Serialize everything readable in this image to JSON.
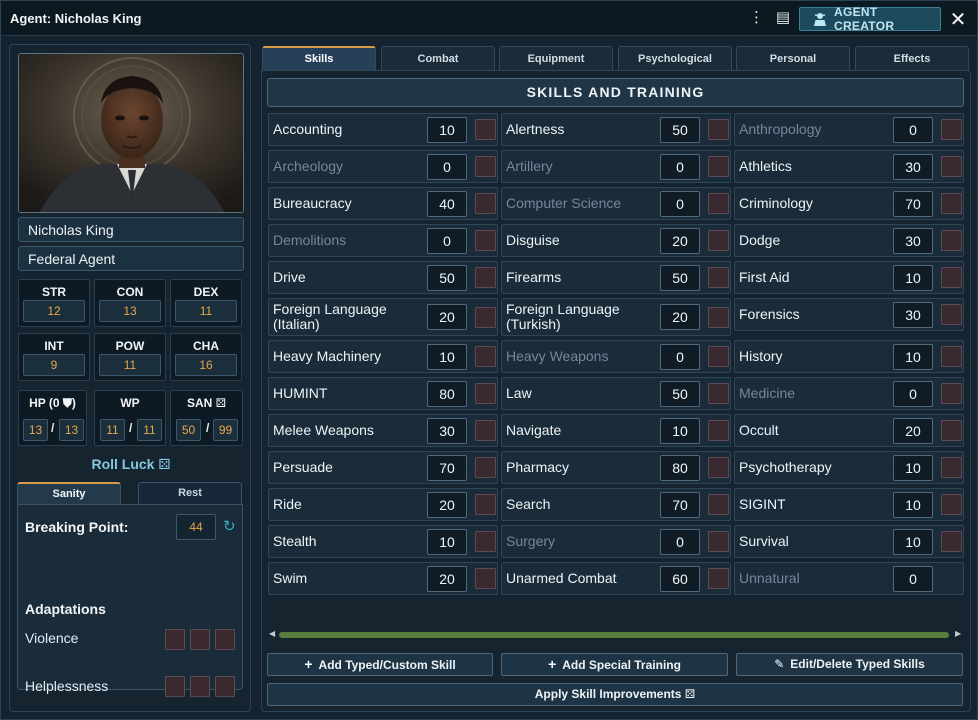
{
  "window": {
    "title": "Agent: Nicholas King",
    "creator_label": "AGENT CREATOR",
    "kebab_glyph": "⋮",
    "sheet_glyph": "▤",
    "close_glyph": "✕"
  },
  "agent": {
    "name": "Nicholas King",
    "profession": "Federal Agent"
  },
  "stats": [
    {
      "label": "STR",
      "value": "12"
    },
    {
      "label": "CON",
      "value": "13"
    },
    {
      "label": "DEX",
      "value": "11"
    },
    {
      "label": "INT",
      "value": "9"
    },
    {
      "label": "POW",
      "value": "11"
    },
    {
      "label": "CHA",
      "value": "16"
    }
  ],
  "derived": {
    "hp": {
      "label": "HP (0 ⛊)",
      "current": "13",
      "max": "13"
    },
    "wp": {
      "label": "WP",
      "current": "11",
      "max": "11"
    },
    "san": {
      "label": "SAN ⚄",
      "current": "50",
      "max": "99"
    }
  },
  "roll_luck": "Roll Luck ⚄",
  "left_tabs": [
    "Sanity",
    "Rest"
  ],
  "sanity": {
    "breaking_point_label": "Breaking Point:",
    "breaking_point": "44",
    "adaptations_title": "Adaptations",
    "adaptations": [
      "Violence",
      "Helplessness"
    ]
  },
  "tabs": [
    "Skills",
    "Combat",
    "Equipment",
    "Psychological",
    "Personal",
    "Effects"
  ],
  "skills_header": "SKILLS AND TRAINING",
  "skills_columns": [
    [
      {
        "name": "Accounting",
        "value": "10",
        "trained": true
      },
      {
        "name": "Archeology",
        "value": "0",
        "trained": false
      },
      {
        "name": "Bureaucracy",
        "value": "40",
        "trained": true
      },
      {
        "name": "Demolitions",
        "value": "0",
        "trained": false
      },
      {
        "name": "Drive",
        "value": "50",
        "trained": true
      },
      {
        "name": "Foreign Language (Italian)",
        "value": "20",
        "trained": true
      },
      {
        "name": "Heavy Machinery",
        "value": "10",
        "trained": true
      },
      {
        "name": "HUMINT",
        "value": "80",
        "trained": true
      },
      {
        "name": "Melee Weapons",
        "value": "30",
        "trained": true
      },
      {
        "name": "Persuade",
        "value": "70",
        "trained": true
      },
      {
        "name": "Ride",
        "value": "20",
        "trained": true
      },
      {
        "name": "Stealth",
        "value": "10",
        "trained": true
      },
      {
        "name": "Swim",
        "value": "20",
        "trained": true
      }
    ],
    [
      {
        "name": "Alertness",
        "value": "50",
        "trained": true
      },
      {
        "name": "Artillery",
        "value": "0",
        "trained": false
      },
      {
        "name": "Computer Science",
        "value": "0",
        "trained": false
      },
      {
        "name": "Disguise",
        "value": "20",
        "trained": true
      },
      {
        "name": "Firearms",
        "value": "50",
        "trained": true
      },
      {
        "name": "Foreign Language (Turkish)",
        "value": "20",
        "trained": true
      },
      {
        "name": "Heavy Weapons",
        "value": "0",
        "trained": false
      },
      {
        "name": "Law",
        "value": "50",
        "trained": true
      },
      {
        "name": "Navigate",
        "value": "10",
        "trained": true
      },
      {
        "name": "Pharmacy",
        "value": "80",
        "trained": true
      },
      {
        "name": "Search",
        "value": "70",
        "trained": true
      },
      {
        "name": "Surgery",
        "value": "0",
        "trained": false
      },
      {
        "name": "Unarmed Combat",
        "value": "60",
        "trained": true
      }
    ],
    [
      {
        "name": "Anthropology",
        "value": "0",
        "trained": false
      },
      {
        "name": "Athletics",
        "value": "30",
        "trained": true
      },
      {
        "name": "Criminology",
        "value": "70",
        "trained": true
      },
      {
        "name": "Dodge",
        "value": "30",
        "trained": true
      },
      {
        "name": "First Aid",
        "value": "10",
        "trained": true
      },
      {
        "name": "Forensics",
        "value": "30",
        "trained": true
      },
      {
        "name": "History",
        "value": "10",
        "trained": true
      },
      {
        "name": "Medicine",
        "value": "0",
        "trained": false
      },
      {
        "name": "Occult",
        "value": "20",
        "trained": true
      },
      {
        "name": "Psychotherapy",
        "value": "10",
        "trained": true
      },
      {
        "name": "SIGINT",
        "value": "10",
        "trained": true
      },
      {
        "name": "Survival",
        "value": "10",
        "trained": true
      },
      {
        "name": "Unnatural",
        "value": "0",
        "trained": false,
        "no_check": true
      }
    ]
  ],
  "buttons": {
    "add_typed": "Add Typed/Custom Skill",
    "add_special": "Add Special Training",
    "edit_delete": "Edit/Delete Typed Skills",
    "apply_improvements": "Apply Skill Improvements ⚄"
  }
}
